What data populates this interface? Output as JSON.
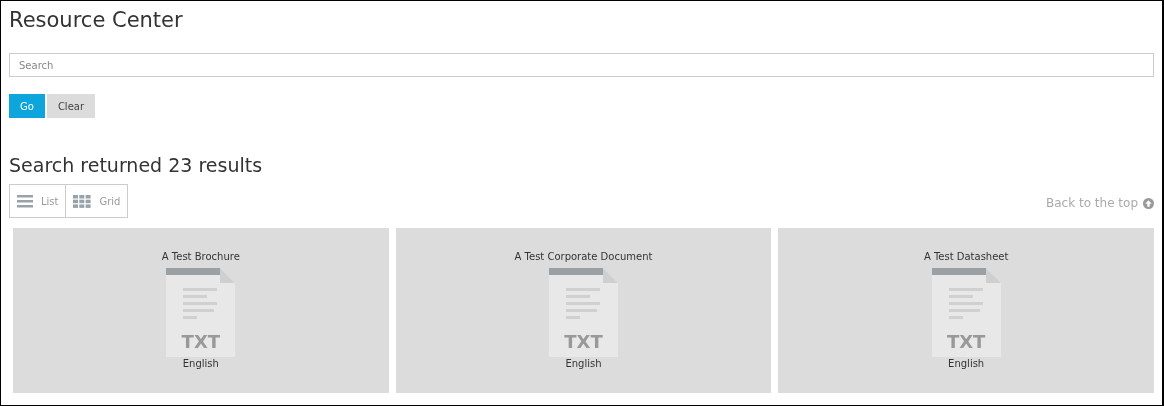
{
  "title": "Resource Center",
  "search": {
    "placeholder": "Search"
  },
  "buttons": [
    {
      "label": "Go",
      "kind": "primary"
    },
    {
      "label": "Clear",
      "kind": "secondary"
    }
  ],
  "results_heading": "Search returned 23 results",
  "view_toggle": [
    {
      "label": "List",
      "kind": "list"
    },
    {
      "label": "Grid",
      "kind": "grid"
    }
  ],
  "back_to_top": "Back to the top",
  "cards": [
    {
      "title": "A Test Brochure",
      "file_type": "TXT",
      "language": "English"
    },
    {
      "title": "A Test Corporate Document",
      "file_type": "TXT",
      "language": "English"
    },
    {
      "title": "A Test Datasheet",
      "file_type": "TXT",
      "language": "English"
    }
  ]
}
